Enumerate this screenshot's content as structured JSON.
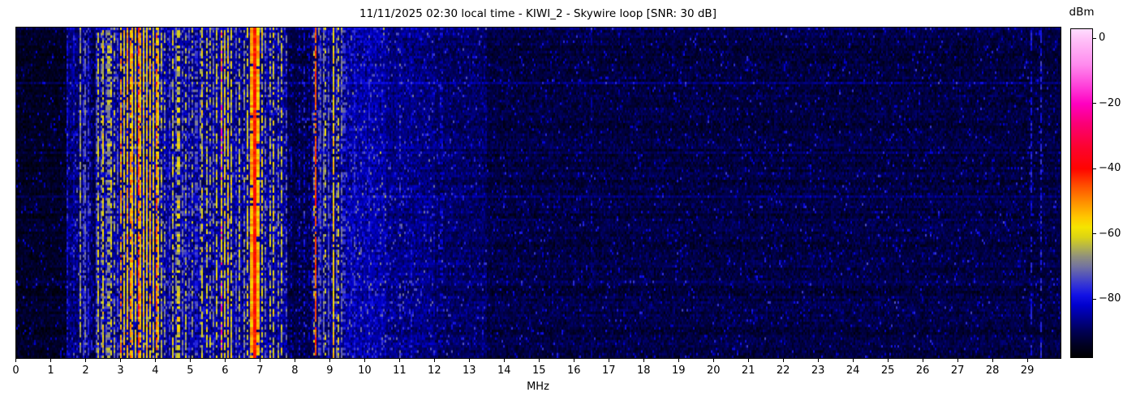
{
  "chart_data": {
    "type": "heatmap",
    "subtype": "radio-spectrum-waterfall",
    "title": "11/11/2025 02:30 local time - KIWI_2 - Skywire loop [SNR: 30 dB]",
    "xlabel": "MHz",
    "x_ticks": [
      0,
      1,
      2,
      3,
      4,
      5,
      6,
      7,
      8,
      9,
      10,
      11,
      12,
      13,
      14,
      15,
      16,
      17,
      18,
      19,
      20,
      21,
      22,
      23,
      24,
      25,
      26,
      27,
      28,
      29
    ],
    "freq_range": [
      0,
      29.94
    ],
    "time_rows": 128,
    "grid": false,
    "legend": "none",
    "colorbar": {
      "label": "dBm",
      "vmin": -98,
      "vmax": 3,
      "ticks": [
        {
          "value": 0,
          "label": "0"
        },
        {
          "value": -20,
          "label": "−20"
        },
        {
          "value": -40,
          "label": "−40"
        },
        {
          "value": -60,
          "label": "−60"
        },
        {
          "value": -80,
          "label": "−80"
        }
      ]
    },
    "colormap_stops": [
      [
        3,
        "#ffddff"
      ],
      [
        0,
        "#ffc2f8"
      ],
      [
        -8,
        "#ff8aee"
      ],
      [
        -15,
        "#ff3bd8"
      ],
      [
        -20,
        "#ff00c0"
      ],
      [
        -26,
        "#fb0077"
      ],
      [
        -33,
        "#fc0332"
      ],
      [
        -40,
        "#ff0400"
      ],
      [
        -45,
        "#ff4c00"
      ],
      [
        -50,
        "#ff8c00"
      ],
      [
        -55,
        "#ffc800"
      ],
      [
        -58,
        "#f5e400"
      ],
      [
        -61,
        "#dcd414"
      ],
      [
        -64,
        "#b4b44a"
      ],
      [
        -67,
        "#90907c"
      ],
      [
        -70,
        "#74749e"
      ],
      [
        -73,
        "#5252bc"
      ],
      [
        -76,
        "#3030d8"
      ],
      [
        -79,
        "#1111e4"
      ],
      [
        -82,
        "#0000cd"
      ],
      [
        -86,
        "#000092"
      ],
      [
        -90,
        "#000055"
      ],
      [
        -94,
        "#000024"
      ],
      [
        -98,
        "#000000"
      ]
    ],
    "seed": 77,
    "background_bands": [
      [
        0.0,
        1.42,
        -94,
        2.2,
        0.05
      ],
      [
        1.42,
        2.12,
        -88,
        3.5,
        0.1
      ],
      [
        2.12,
        2.3,
        -91,
        3.0,
        0.08
      ],
      [
        2.3,
        7.78,
        -86,
        4.0,
        0.12
      ],
      [
        7.78,
        8.45,
        -91,
        2.8,
        0.06
      ],
      [
        8.45,
        9.45,
        -87,
        3.5,
        0.1
      ],
      [
        9.45,
        10.6,
        -84.5,
        3.8,
        0.12
      ],
      [
        10.6,
        12.0,
        -87,
        3.2,
        0.08
      ],
      [
        12.0,
        13.5,
        -89,
        2.8,
        0.06
      ],
      [
        13.5,
        29.94,
        -91.5,
        2.6,
        0.045
      ]
    ],
    "signal_stripes": [
      [
        1.48,
        0.018,
        -79,
        3,
        0.55
      ],
      [
        1.63,
        0.015,
        -83,
        2.5,
        0.4
      ],
      [
        1.84,
        0.02,
        -67,
        4,
        0.8
      ],
      [
        1.91,
        0.018,
        -76,
        3,
        0.7
      ],
      [
        1.98,
        0.025,
        -72,
        4,
        0.75
      ],
      [
        2.06,
        0.018,
        -77,
        3,
        0.6
      ],
      [
        2.17,
        0.015,
        -84,
        2.5,
        0.4
      ],
      [
        2.28,
        0.018,
        -75,
        4,
        0.6
      ],
      [
        2.35,
        0.02,
        -63,
        5,
        0.6
      ],
      [
        2.42,
        0.018,
        -70,
        5,
        0.6
      ],
      [
        2.5,
        0.025,
        -60,
        5,
        0.8
      ],
      [
        2.57,
        0.018,
        -72,
        4,
        0.6
      ],
      [
        2.65,
        0.025,
        -67,
        5,
        0.7
      ],
      [
        2.73,
        0.025,
        -62,
        5,
        0.65
      ],
      [
        2.82,
        0.02,
        -66,
        6,
        0.55
      ],
      [
        2.9,
        0.018,
        -73,
        4,
        0.6
      ],
      [
        2.99,
        0.022,
        -52,
        6,
        0.78
      ],
      [
        3.08,
        0.028,
        -59,
        5,
        0.85
      ],
      [
        3.17,
        0.028,
        -55,
        6,
        0.85
      ],
      [
        3.27,
        0.025,
        -52,
        5,
        0.8
      ],
      [
        3.34,
        0.028,
        -56,
        6,
        0.9
      ],
      [
        3.42,
        0.028,
        -60,
        5,
        0.9
      ],
      [
        3.5,
        0.022,
        -47,
        6,
        0.9
      ],
      [
        3.57,
        0.028,
        -55,
        5,
        0.9
      ],
      [
        3.65,
        0.032,
        -58,
        5,
        0.92
      ],
      [
        3.74,
        0.032,
        -57,
        5,
        0.92
      ],
      [
        3.83,
        0.028,
        -54,
        6,
        0.88
      ],
      [
        3.92,
        0.028,
        -59,
        5,
        0.85
      ],
      [
        4.0,
        0.022,
        -49,
        6,
        0.85
      ],
      [
        4.08,
        0.028,
        -60,
        5,
        0.8
      ],
      [
        4.17,
        0.025,
        -64,
        5,
        0.7
      ],
      [
        4.27,
        0.02,
        -68,
        5,
        0.6
      ],
      [
        4.38,
        0.018,
        -74,
        4,
        0.6
      ],
      [
        4.47,
        0.022,
        -62,
        5,
        0.65
      ],
      [
        4.56,
        0.018,
        -70,
        4,
        0.6
      ],
      [
        4.65,
        0.022,
        -61,
        5,
        0.65
      ],
      [
        4.76,
        0.018,
        -72,
        4,
        0.6
      ],
      [
        4.85,
        0.018,
        -65,
        5,
        0.5
      ],
      [
        4.95,
        0.018,
        -74,
        4,
        0.6
      ],
      [
        5.06,
        0.018,
        -68,
        5,
        0.5
      ],
      [
        5.16,
        0.018,
        -75,
        4,
        0.55
      ],
      [
        5.26,
        0.018,
        -70,
        5,
        0.5
      ],
      [
        5.34,
        0.022,
        -61,
        5,
        0.7
      ],
      [
        5.45,
        0.022,
        -63,
        5,
        0.65
      ],
      [
        5.56,
        0.022,
        -66,
        5,
        0.6
      ],
      [
        5.66,
        0.018,
        -70,
        4,
        0.55
      ],
      [
        5.76,
        0.022,
        -62,
        5,
        0.7
      ],
      [
        5.87,
        0.028,
        -58,
        5,
        0.85
      ],
      [
        5.87,
        0.01,
        -22,
        4,
        0.3
      ],
      [
        5.98,
        0.028,
        -60,
        5,
        0.8
      ],
      [
        6.08,
        0.028,
        -58,
        5,
        0.8
      ],
      [
        6.18,
        0.022,
        -62,
        5,
        0.7
      ],
      [
        6.3,
        0.018,
        -72,
        4,
        0.6
      ],
      [
        6.4,
        0.022,
        -64,
        5,
        0.6
      ],
      [
        6.52,
        0.018,
        -69,
        5,
        0.55
      ],
      [
        6.63,
        0.022,
        -61,
        5,
        0.65
      ],
      [
        6.74,
        0.04,
        -53,
        4,
        0.95
      ],
      [
        6.83,
        0.045,
        -41,
        2.5,
        1.0
      ],
      [
        6.93,
        0.04,
        -54,
        4,
        0.92
      ],
      [
        7.04,
        0.022,
        -61,
        5,
        0.7
      ],
      [
        7.15,
        0.018,
        -70,
        4,
        0.55
      ],
      [
        7.26,
        0.022,
        -64,
        5,
        0.6
      ],
      [
        7.38,
        0.022,
        -62,
        5,
        0.65
      ],
      [
        7.5,
        0.018,
        -68,
        5,
        0.55
      ],
      [
        7.6,
        0.022,
        -63,
        5,
        0.6
      ],
      [
        7.72,
        0.018,
        -73,
        4,
        0.5
      ],
      [
        7.9,
        0.012,
        -82,
        2.5,
        0.35
      ],
      [
        8.1,
        0.012,
        -80,
        2.5,
        0.35
      ],
      [
        8.27,
        0.012,
        -79,
        2.5,
        0.35
      ],
      [
        8.38,
        0.012,
        -81,
        2.5,
        0.3
      ],
      [
        8.52,
        0.02,
        -67,
        5,
        0.4
      ],
      [
        8.58,
        0.014,
        -45,
        4,
        0.85
      ],
      [
        8.66,
        0.015,
        -72,
        4,
        0.5
      ],
      [
        8.73,
        0.018,
        -74,
        4,
        0.7
      ],
      [
        8.8,
        0.018,
        -70,
        4,
        0.7
      ],
      [
        8.87,
        0.02,
        -63,
        6,
        0.5
      ],
      [
        8.95,
        0.018,
        -73,
        4,
        0.7
      ],
      [
        9.07,
        0.02,
        -57,
        4,
        0.9
      ],
      [
        9.16,
        0.018,
        -72,
        4,
        0.6
      ],
      [
        9.24,
        0.018,
        -62,
        5,
        0.55
      ],
      [
        9.32,
        0.018,
        -70,
        4,
        0.6
      ],
      [
        9.39,
        0.014,
        -75,
        3,
        0.5
      ],
      [
        9.7,
        0.013,
        -77,
        3,
        0.55
      ],
      [
        10.13,
        0.012,
        -79,
        3,
        0.45
      ],
      [
        11.0,
        0.012,
        -74,
        4,
        0.3
      ],
      [
        11.3,
        0.012,
        -80,
        3,
        0.35
      ],
      [
        12.18,
        0.012,
        -82,
        2.5,
        0.3
      ],
      [
        16.5,
        0.012,
        -87,
        2,
        0.35
      ],
      [
        29.08,
        0.012,
        -79,
        2.5,
        0.5
      ],
      [
        29.38,
        0.012,
        -77,
        2.5,
        0.6
      ]
    ]
  }
}
